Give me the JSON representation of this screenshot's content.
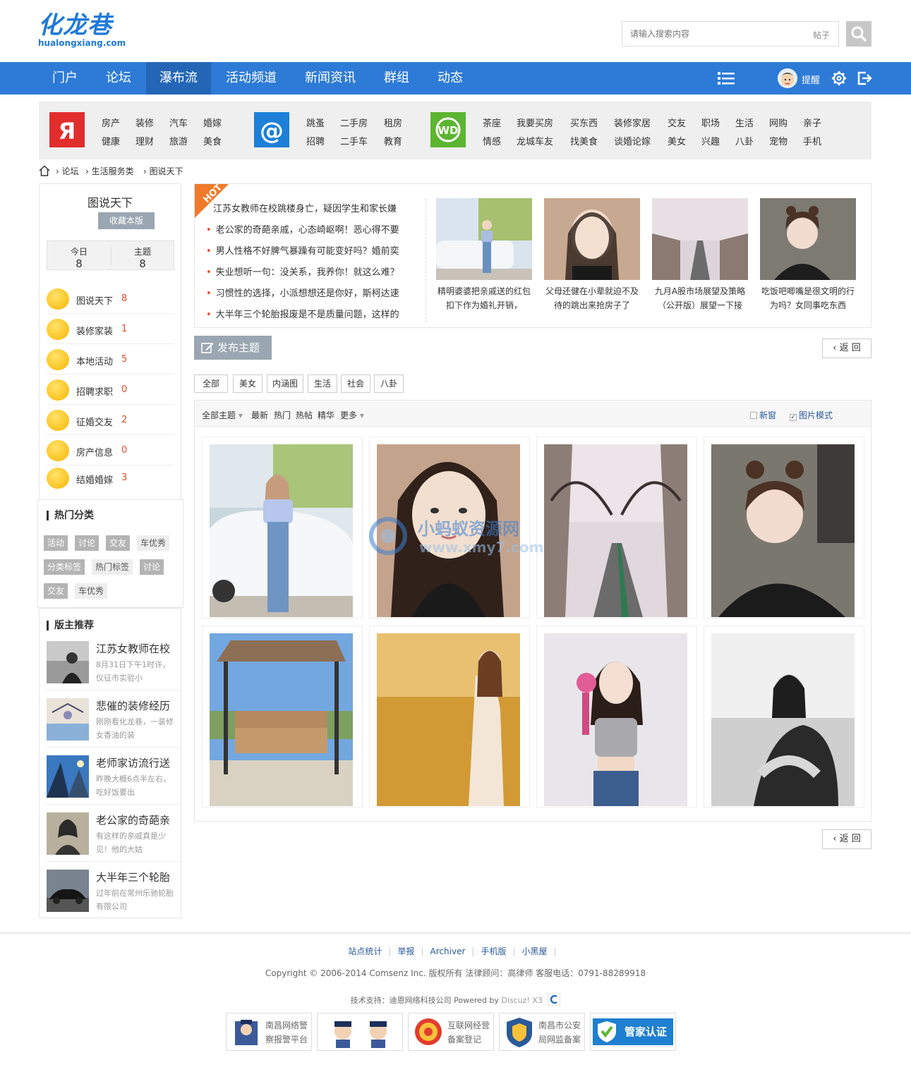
{
  "logo": {
    "name": "化龙巷",
    "domain": "hualongxiang.com"
  },
  "search": {
    "placeholder": "请输入搜索内容",
    "type": "帖子"
  },
  "nav": {
    "items": [
      "门户",
      "论坛",
      "瀑布流",
      "活动频道",
      "新闻资讯",
      "群组",
      "动态"
    ],
    "active": "瀑布流",
    "remind": "提醒"
  },
  "catbar": {
    "group1": [
      "房产",
      "装修",
      "汽车",
      "婚嫁",
      "健康",
      "理财",
      "旅游",
      "美食"
    ],
    "group2": [
      "跳蚤",
      "二手房",
      "租房",
      "招聘",
      "二手车",
      "教育"
    ],
    "group3": [
      "茶座",
      "我要买房",
      "买东西",
      "装修家居",
      "交友",
      "职场",
      "生活",
      "网购",
      "亲子",
      "情感",
      "龙城车友",
      "找美食",
      "谈婚论嫁",
      "美女",
      "兴趣",
      "八卦",
      "宠物",
      "手机"
    ],
    "colors": {
      "yandex": "#e22d2d",
      "at": "#1d7fd8",
      "wd": "#5cb531"
    }
  },
  "breadcrumb": [
    "论坛",
    "生活服务类",
    "图说天下"
  ],
  "forum": {
    "title": "图说天下",
    "fav_label": "收藏本版",
    "today_label": "今日",
    "today": "8",
    "topics_label": "主题",
    "topics": "8",
    "boards": [
      {
        "name": "图说天下",
        "count": "8"
      },
      {
        "name": "装修家装",
        "count": "1"
      },
      {
        "name": "本地活动",
        "count": "5"
      },
      {
        "name": "招聘求职",
        "count": "0"
      },
      {
        "name": "征婚交友",
        "count": "2"
      },
      {
        "name": "房产信息",
        "count": "0"
      },
      {
        "name": "结婚婚嫁",
        "count": "3"
      }
    ]
  },
  "hot_category": {
    "title": "热门分类",
    "tags": [
      "活动",
      "讨论",
      "交友",
      "车优秀",
      "分类标签",
      "热门标签",
      "讨论",
      "交友",
      "车优秀"
    ]
  },
  "moderator_rec": {
    "title": "版主推荐",
    "items": [
      {
        "title": "江苏女教师在校",
        "desc": "8月31日下午1时许，仪征市实验小"
      },
      {
        "title": "悲催的装修经历",
        "desc": "刚刚看化龙巷，一装修女香油的装"
      },
      {
        "title": "老师家访流行送",
        "desc": "昨晚大概6点半左右，吃好饭要出"
      },
      {
        "title": "老公家的奇葩亲",
        "desc": "有这样的亲戚真是少见！他的大姑"
      },
      {
        "title": "大半年三个轮胎",
        "desc": "过年前在常州乐驰轮胎有限公司"
      }
    ]
  },
  "hot": {
    "ribbon": "HOT",
    "lines": [
      "江苏女教师在校跳楼身亡，疑因学生和家长嫌",
      "老公家的奇葩亲戚，心态崎岖啊！恶心得不要",
      "男人性格不好脾气暴躁有可能变好吗？婚前奕",
      "失业想听一句：没关系，我养你！就这么难？",
      "习惯性的选择，小派想想还是你好，斯柯达速",
      "大半年三个轮胎报废是不是质量问题，这样的"
    ],
    "pics": [
      {
        "cap1": "精明婆婆把亲戚送的红包",
        "cap2": "扣下作为婚礼开销，"
      },
      {
        "cap1": "父母还健在小辈就迫不及",
        "cap2": "待的跳出来抢房子了"
      },
      {
        "cap1": "九月A股市场展望及策略",
        "cap2": "（公开版）展望一下接"
      },
      {
        "cap1": "吃饭吧唧嘴是很文明的行",
        "cap2": "为吗？女同事吃东西"
      }
    ]
  },
  "post_label": "发布主题",
  "back_label": "返 回",
  "filters": [
    "全部",
    "美女",
    "内涵图",
    "生活",
    "社会",
    "八卦"
  ],
  "list_head": {
    "all": "全部主题",
    "sorts": [
      "最新",
      "热门",
      "热帖",
      "精华",
      "更多"
    ],
    "new_window": "新窗",
    "pic_mode": "图片模式"
  },
  "footer": {
    "links": [
      "站点统计",
      "举报",
      "Archiver",
      "手机版",
      "小黑屋"
    ],
    "copyright": "Copyright © 2006-2014   Comsenz Inc. 版权所有   法律顾问：高律师   客服电话：0791-88289918",
    "tech": "技术支持：迪恩网络科技公司   Powered by ",
    "discuz": "Discuz! X3",
    "badges": [
      {
        "l1": "南昌网络警",
        "l2": "察报警平台"
      },
      {
        "l1": "",
        "l2": ""
      },
      {
        "l1": "互联网经营",
        "l2": "备案登记"
      },
      {
        "l1": "南昌市公安",
        "l2": "局网监备案"
      },
      {
        "l1": "管家认证",
        "l2": ""
      }
    ]
  },
  "watermark": {
    "cn": "小蚂蚁资源网",
    "url": "www.xmy7.com"
  }
}
